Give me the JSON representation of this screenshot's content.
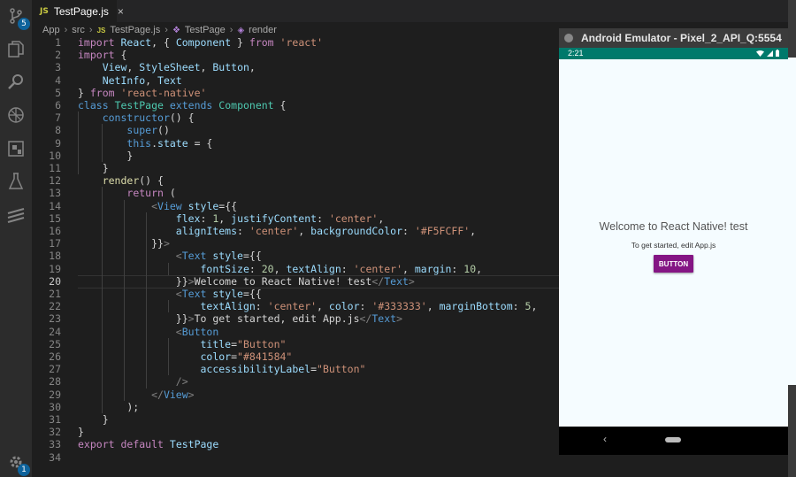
{
  "activity_bar": {
    "scm_badge": "5",
    "settings_badge": "1"
  },
  "tab": {
    "icon_text": "JS",
    "title": "TestPage.js",
    "close": "×"
  },
  "breadcrumb": [
    "App",
    "src",
    "TestPage.js",
    "TestPage",
    "render"
  ],
  "code": {
    "line_numbers": [
      "1",
      "2",
      "3",
      "4",
      "5",
      "6",
      "7",
      "8",
      "9",
      "10",
      "11",
      "12",
      "13",
      "14",
      "15",
      "16",
      "17",
      "18",
      "19",
      "20",
      "21",
      "22",
      "23",
      "24",
      "25",
      "26",
      "27",
      "28",
      "29",
      "30",
      "31",
      "32",
      "33",
      "34"
    ],
    "current_line": 20
  },
  "emulator": {
    "title": "Android Emulator - Pixel_2_API_Q:5554",
    "time": "2:21",
    "welcome_text": "Welcome to React Native! test",
    "instructions_text": "To get started, edit App.js",
    "button_label": "BUTTON",
    "nav_back": "‹"
  },
  "colors": {
    "button": "#841584",
    "screen_background": "#F5FCFF",
    "status_bar": "#00796b"
  }
}
